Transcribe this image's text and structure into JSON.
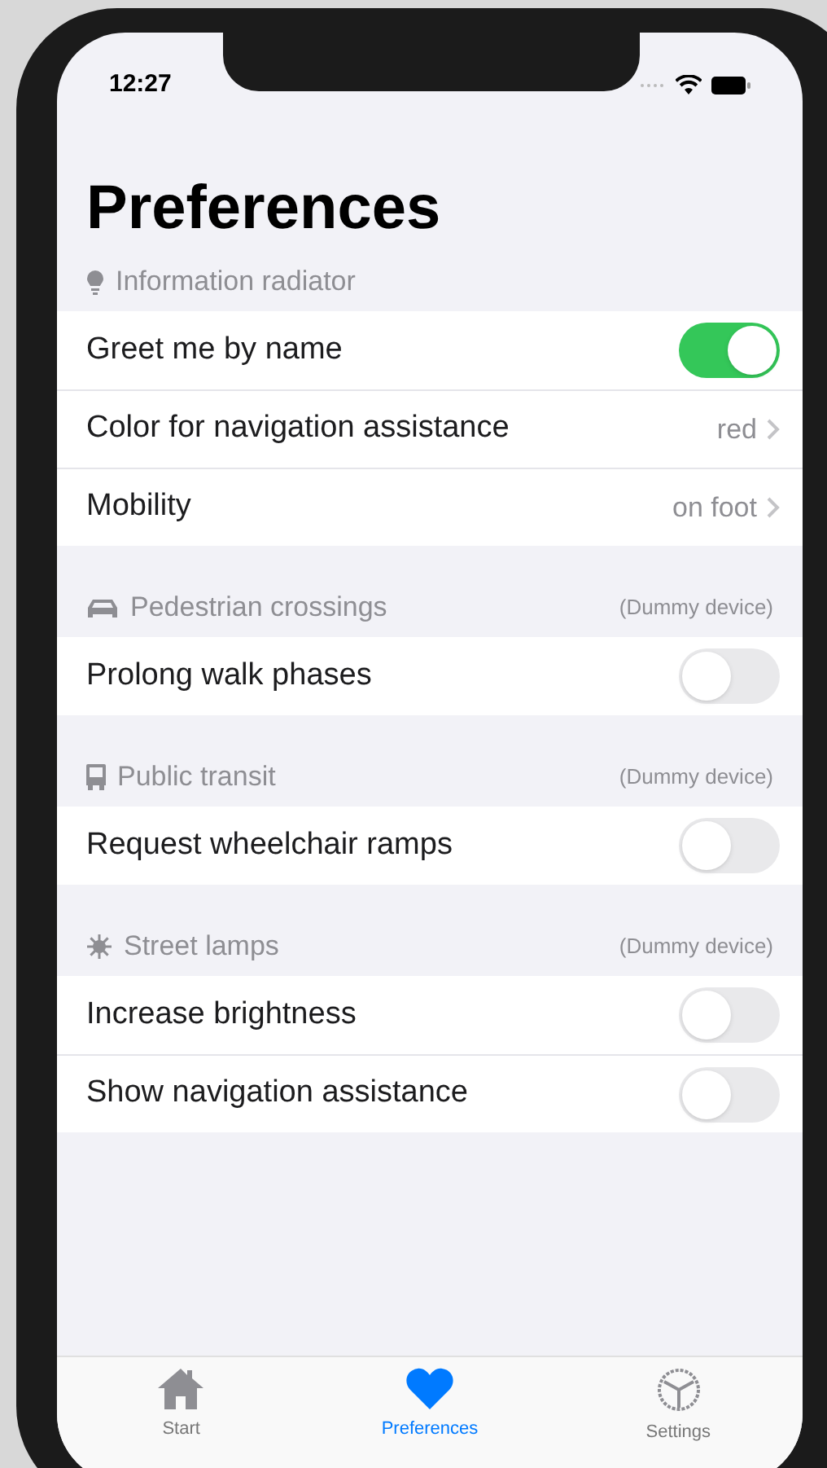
{
  "status_bar": {
    "time": "12:27"
  },
  "title": "Preferences",
  "sections": [
    {
      "title": "Information radiator",
      "rows": [
        {
          "kind": "toggle",
          "label": "Greet me by name",
          "on": true
        },
        {
          "kind": "disclosure",
          "label": "Color for navigation assistance",
          "value": "red"
        },
        {
          "kind": "disclosure",
          "label": "Mobility",
          "value": "on foot"
        }
      ]
    },
    {
      "title": "Pedestrian crossings",
      "note": "(Dummy device)",
      "rows": [
        {
          "kind": "toggle",
          "label": "Prolong walk phases",
          "on": false
        }
      ]
    },
    {
      "title": "Public transit",
      "note": "(Dummy device)",
      "rows": [
        {
          "kind": "toggle",
          "label": "Request wheelchair ramps",
          "on": false
        }
      ]
    },
    {
      "title": "Street lamps",
      "note": "(Dummy device)",
      "rows": [
        {
          "kind": "toggle",
          "label": "Increase brightness",
          "on": false
        },
        {
          "kind": "toggle",
          "label": "Show navigation assistance",
          "on": false
        }
      ]
    }
  ],
  "tab_bar": [
    {
      "label": "Start",
      "selected": false
    },
    {
      "label": "Preferences",
      "selected": true
    },
    {
      "label": "Settings",
      "selected": false
    }
  ]
}
